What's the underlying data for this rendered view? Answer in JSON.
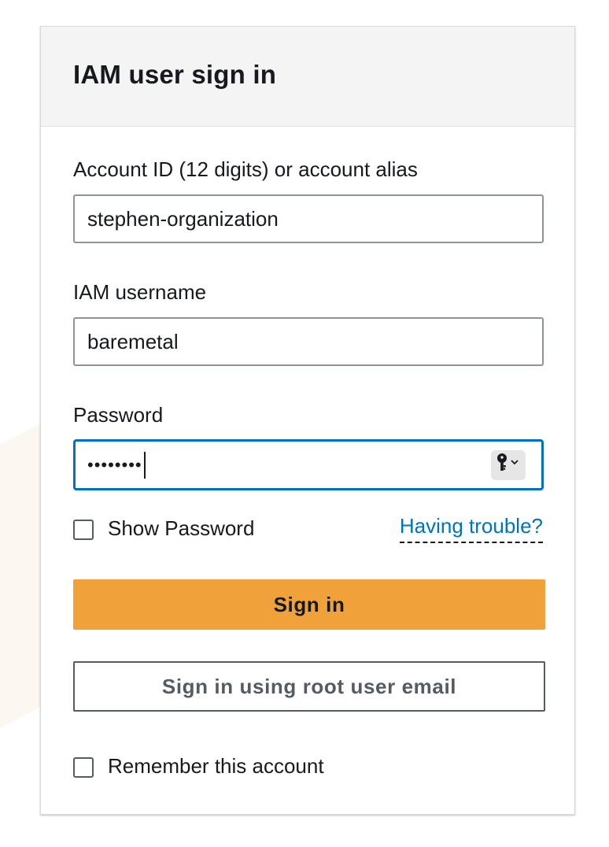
{
  "title": "IAM user sign in",
  "account": {
    "label": "Account ID (12 digits) or account alias",
    "value": "stephen-organization"
  },
  "username": {
    "label": "IAM username",
    "value": "baremetal"
  },
  "password": {
    "label": "Password",
    "masked_value": "••••••••",
    "autofill_icon": "key-icon"
  },
  "show_password": {
    "label": "Show Password",
    "checked": false
  },
  "trouble_link": "Having trouble?",
  "sign_in_button": "Sign in",
  "root_sign_in_button": "Sign in using root user email",
  "remember": {
    "label": "Remember this account",
    "checked": false
  },
  "colors": {
    "primary_button": "#f0a139",
    "link": "#0073bb",
    "focus_border": "#0073bb"
  }
}
